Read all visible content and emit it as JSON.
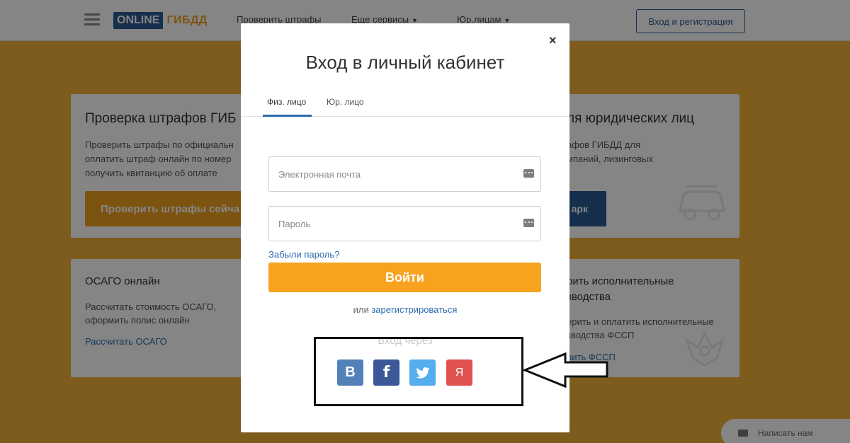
{
  "header": {
    "logo_online": "ONLINE",
    "logo_gibdd": "ГИБДД",
    "nav_check": "Проверить штрафы",
    "nav_more": "Еще сервисы",
    "nav_legal": "Юр.лицам",
    "login_button": "Вход и регистрация"
  },
  "background": {
    "card1": {
      "title": "Проверка штрафов ГИБ",
      "line1": "Проверить штрафы по официальн",
      "line2": "оплатить штраф онлайн по номер",
      "line3": "получить квитанцию об оплате",
      "button": "Проверить штрафы сейча"
    },
    "card2": {
      "title": "ля юридических лиц",
      "line1": "афов ГИБДД для",
      "line2": "мпаний, лизинговых",
      "button": "арк"
    },
    "card3": {
      "title": "ОСАГО онлайн",
      "line1": "Рассчитать стоимость ОСАГО,",
      "line2": "оформить полис онлайн",
      "link": "Рассчитать ОСАГО"
    },
    "card4": {
      "title1": "рить исполнительные",
      "title2": "зводства",
      "line1": "ерить и оплатить исполнительные",
      "line2": "зводства ФССП",
      "link": "рить ФССП"
    },
    "chat": "Написать нам"
  },
  "modal": {
    "close": "×",
    "title": "Вход в личный кабинет",
    "tab_person": "Физ. лицо",
    "tab_legal": "Юр. лицо",
    "email_placeholder": "Электронная почта",
    "password_placeholder": "Пароль",
    "forgot": "Забыли пароль?",
    "submit": "Войти",
    "or": "или",
    "register": "зарегистрироваться",
    "via": "Вход через",
    "social": [
      {
        "glyph": "В",
        "color": "#5181b8",
        "icon": "vk-icon"
      },
      {
        "glyph": "f",
        "color": "#3b5998",
        "icon": "facebook-icon"
      },
      {
        "glyph": "t",
        "color": "#55acee",
        "icon": "twitter-icon"
      },
      {
        "glyph": "Я",
        "color": "#e0524f",
        "icon": "yandex-icon"
      }
    ]
  }
}
